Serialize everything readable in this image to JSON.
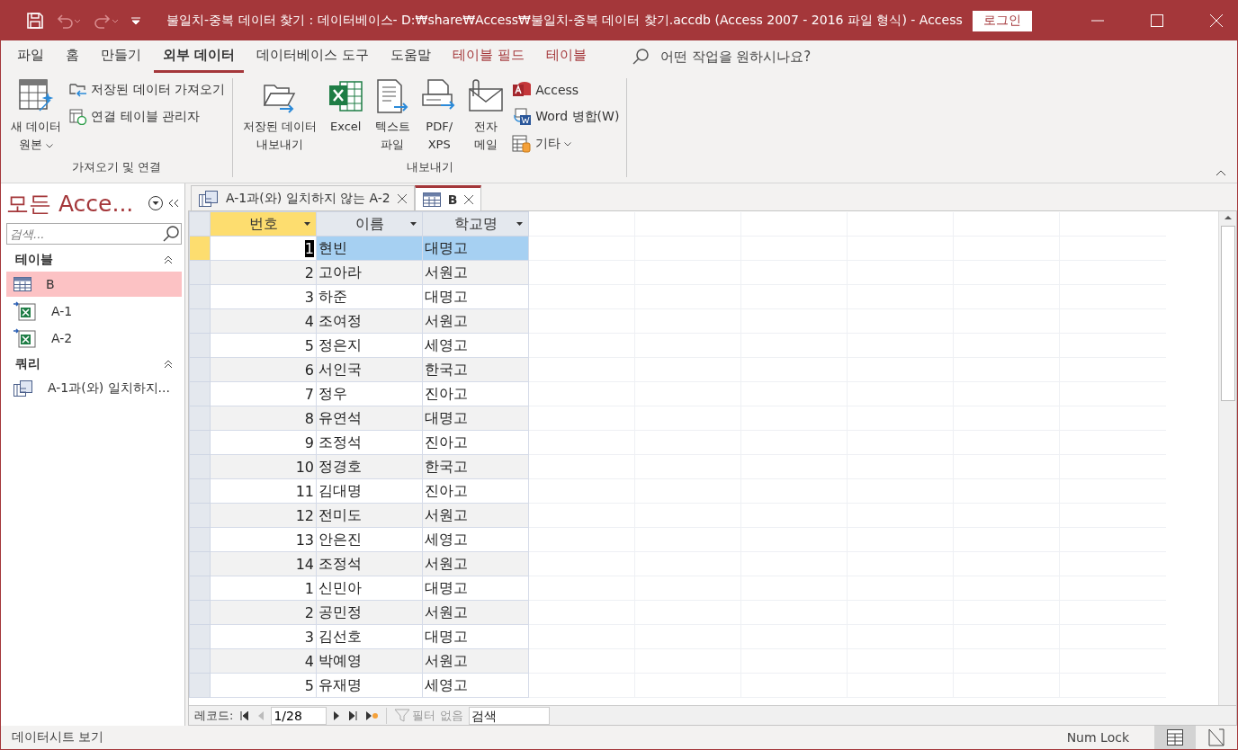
{
  "title_bar": {
    "title": "불일치-중복 데이터 찾기 : 데이터베이스- D:₩share₩Access₩불일치-중복 데이터 찾기.accdb (Access 2007 - 2016 파일 형식)  -  Access",
    "login": "로그인"
  },
  "menu_tabs": [
    {
      "label": "파일",
      "selected": false,
      "kind": "normal"
    },
    {
      "label": "홈",
      "selected": false,
      "kind": "normal"
    },
    {
      "label": "만들기",
      "selected": false,
      "kind": "normal"
    },
    {
      "label": "외부 데이터",
      "selected": true,
      "kind": "normal"
    },
    {
      "label": "데이터베이스 도구",
      "selected": false,
      "kind": "normal"
    },
    {
      "label": "도움말",
      "selected": false,
      "kind": "normal"
    },
    {
      "label": "테이블 필드",
      "selected": false,
      "kind": "context"
    },
    {
      "label": "테이블",
      "selected": false,
      "kind": "context"
    }
  ],
  "tell_me": {
    "placeholder": "어떤 작업을 원하시나요?"
  },
  "ribbon_groups": [
    {
      "label": "가져오기 및 연결",
      "buttons": [
        {
          "label": "새 데이터\n원본",
          "kind": "large",
          "dropdown": true
        },
        {
          "label": "저장된 데이터 가져오기",
          "kind": "small",
          "dropdown": false
        },
        {
          "label": "연결 테이블 관리자",
          "kind": "small",
          "dropdown": false
        }
      ]
    },
    {
      "label": "내보내기",
      "buttons": [
        {
          "label": "저장된 데이터\n내보내기",
          "kind": "large",
          "dropdown": false
        },
        {
          "label": "Excel",
          "kind": "large",
          "dropdown": false
        },
        {
          "label": "텍스트\n파일",
          "kind": "large",
          "dropdown": false
        },
        {
          "label": "PDF/\nXPS",
          "kind": "large",
          "dropdown": false
        },
        {
          "label": "전자\n메일",
          "kind": "large",
          "dropdown": false
        },
        {
          "label": "Access",
          "kind": "small",
          "dropdown": false
        },
        {
          "label": "Word 병합(W)",
          "kind": "small",
          "dropdown": false
        },
        {
          "label": "기타",
          "kind": "small",
          "dropdown": true
        }
      ]
    }
  ],
  "nav_pane": {
    "title": "모든 Acce...",
    "search": {
      "placeholder": "검색..."
    },
    "groups": [
      {
        "label": "테이블",
        "items": [
          {
            "label": "B",
            "kind": "table",
            "selected": true
          },
          {
            "label": "A-1",
            "kind": "linked_excel",
            "selected": false
          },
          {
            "label": "A-2",
            "kind": "linked_excel",
            "selected": false
          }
        ]
      },
      {
        "label": "쿼리",
        "items": [
          {
            "label": "A-1과(와) 일치하지...",
            "kind": "query",
            "selected": false
          }
        ]
      }
    ]
  },
  "doc_tabs": [
    {
      "label": "A-1과(와) 일치하지 않는 A-2",
      "kind": "query",
      "selected": false
    },
    {
      "label": "B",
      "kind": "table",
      "selected": true
    }
  ],
  "table": {
    "columns": [
      {
        "label": "번호",
        "selected": true
      },
      {
        "label": "이름",
        "selected": false
      },
      {
        "label": "학교명",
        "selected": false
      }
    ],
    "rows": [
      {
        "cells": [
          "1",
          "현빈",
          "대명고"
        ],
        "selected": true
      },
      {
        "cells": [
          "2",
          "고아라",
          "서원고"
        ],
        "selected": false
      },
      {
        "cells": [
          "3",
          "하준",
          "대명고"
        ],
        "selected": false
      },
      {
        "cells": [
          "4",
          "조여정",
          "서원고"
        ],
        "selected": false
      },
      {
        "cells": [
          "5",
          "정은지",
          "세영고"
        ],
        "selected": false
      },
      {
        "cells": [
          "6",
          "서인국",
          "한국고"
        ],
        "selected": false
      },
      {
        "cells": [
          "7",
          "정우",
          "진아고"
        ],
        "selected": false
      },
      {
        "cells": [
          "8",
          "유연석",
          "대명고"
        ],
        "selected": false
      },
      {
        "cells": [
          "9",
          "조정석",
          "진아고"
        ],
        "selected": false
      },
      {
        "cells": [
          "10",
          "정경호",
          "한국고"
        ],
        "selected": false
      },
      {
        "cells": [
          "11",
          "김대명",
          "진아고"
        ],
        "selected": false
      },
      {
        "cells": [
          "12",
          "전미도",
          "서원고"
        ],
        "selected": false
      },
      {
        "cells": [
          "13",
          "안은진",
          "세영고"
        ],
        "selected": false
      },
      {
        "cells": [
          "14",
          "조정석",
          "서원고"
        ],
        "selected": false
      },
      {
        "cells": [
          "1",
          "신민아",
          "대명고"
        ],
        "selected": false
      },
      {
        "cells": [
          "2",
          "공민정",
          "서원고"
        ],
        "selected": false
      },
      {
        "cells": [
          "3",
          "김선호",
          "대명고"
        ],
        "selected": false
      },
      {
        "cells": [
          "4",
          "박예영",
          "서원고"
        ],
        "selected": false
      },
      {
        "cells": [
          "5",
          "유재명",
          "세영고"
        ],
        "selected": false
      }
    ]
  },
  "record_nav": {
    "label": "레코드:",
    "position": "1/28",
    "filter": "필터 없음",
    "search": {
      "placeholder": "검색"
    }
  },
  "status_bar": {
    "text": "데이터시트 보기",
    "num_lock": "Num Lock",
    "views": [
      {
        "kind": "datasheet",
        "selected": true
      },
      {
        "kind": "design",
        "selected": false
      }
    ]
  }
}
